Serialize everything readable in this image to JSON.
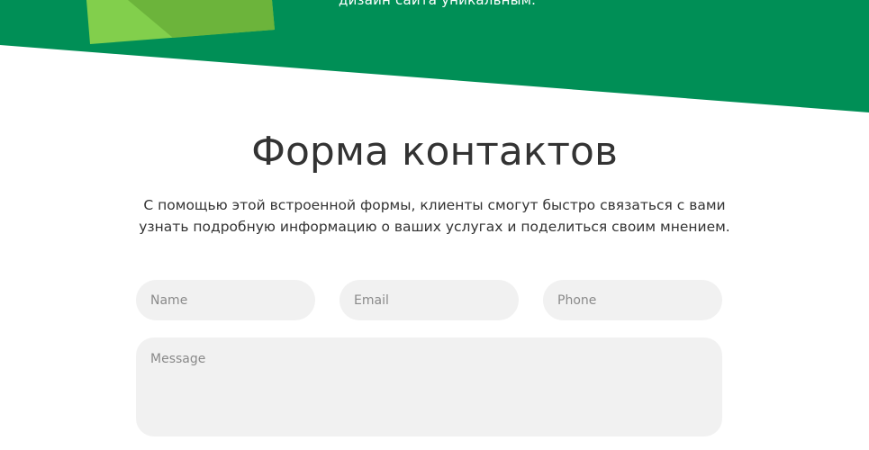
{
  "banner": {
    "text": "дизайн сайта уникальным.",
    "colors": {
      "background": "#008f56",
      "shape_light": "#82cf4c",
      "shape_dark": "#6cb43b"
    }
  },
  "section": {
    "title": "Форма контактов",
    "description": "С помощью этой встроенной формы, клиенты смогут быстро связаться с вами узнать подробную информацию о ваших услугах и поделиться своим мнением."
  },
  "form": {
    "name": {
      "placeholder": "Name",
      "value": ""
    },
    "email": {
      "placeholder": "Email",
      "value": ""
    },
    "phone": {
      "placeholder": "Phone",
      "value": ""
    },
    "message": {
      "placeholder": "Message",
      "value": ""
    }
  },
  "colors": {
    "text": "#333333",
    "field_background": "#f1f1f1",
    "placeholder": "#8a8a8a"
  }
}
